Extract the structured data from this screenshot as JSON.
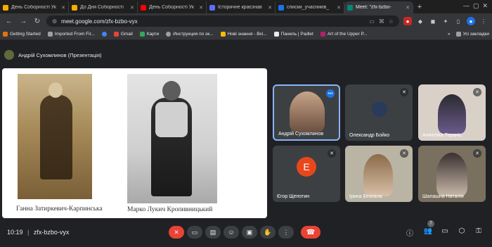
{
  "browser": {
    "tabs": [
      {
        "title": "День Соборності Ук",
        "color": "#f9ab00"
      },
      {
        "title": "До Дня Соборності",
        "color": "#f9ab00"
      },
      {
        "title": "День Соборності Ук",
        "color": "#ff0000"
      },
      {
        "title": "Історичне краєзнав",
        "color": "#5f6bff"
      },
      {
        "title": "списки_учасників_",
        "color": "#1a73e8"
      },
      {
        "title": "Meet: \"zfx-bzbo-",
        "color": "#00897b"
      }
    ],
    "url": "meet.google.com/zfx-bzbo-vyx",
    "bookmarks": [
      "Getting Started",
      "Imported From Fir...",
      "Gmail",
      "Карти",
      "Инструкция по эк...",
      "Нові знання - Вхі...",
      "Панель | Padlet",
      "Art of the Upper P..."
    ],
    "bookmarks_all": "Усі закладки"
  },
  "meet": {
    "presenter_label": "Андрій Сухомлинов (Презентація)",
    "slide": {
      "caption_left": "Ганна Затиркевич-Карпинська",
      "caption_right": "Марко Лукич Кропивницький"
    },
    "participants": [
      {
        "name": "Андрій Сухомлинов"
      },
      {
        "name": "Олександр Бойко"
      },
      {
        "name": "Анжеліка Тераніс"
      },
      {
        "name": "Єгор Щепотин",
        "initial": "Е"
      },
      {
        "name": "Ірина Безпала"
      },
      {
        "name": "Шалашна Наталія"
      }
    ],
    "time": "10:19",
    "code": "zfx-bzbo-vyx",
    "people_count": "7"
  }
}
